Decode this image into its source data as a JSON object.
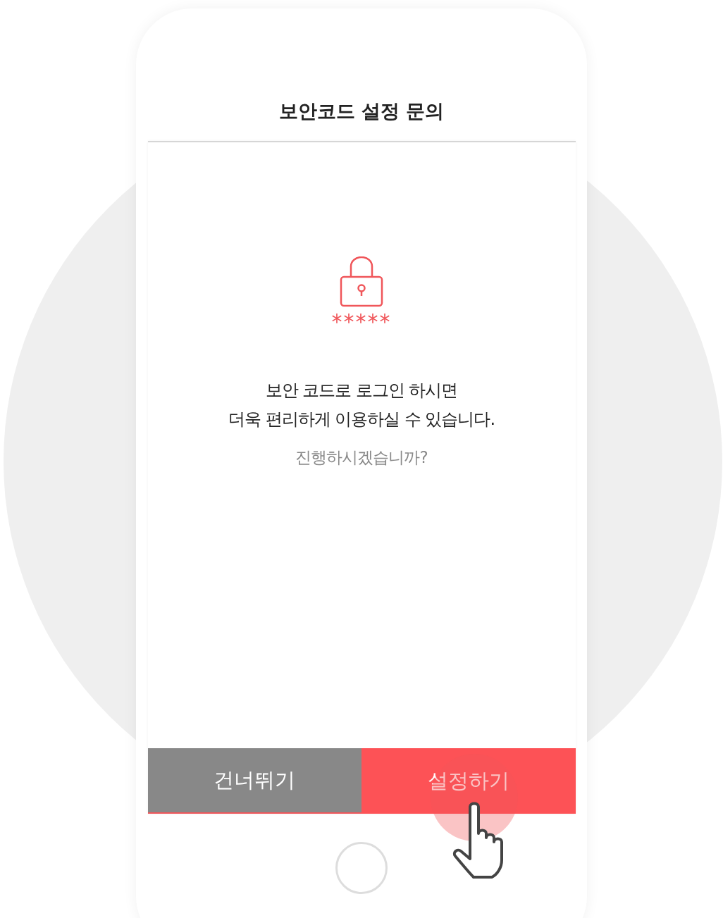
{
  "title": "보안코드 설정 문의",
  "masked_code": "*****",
  "message_lines": [
    "보안 코드로 로그인 하시면",
    "더욱 편리하게 이용하실 수 있습니다."
  ],
  "question": "진행하시겠습니까?",
  "buttons": [
    {
      "label": "건너뛰기",
      "kind": "secondary"
    },
    {
      "label": "설정하기",
      "kind": "primary"
    }
  ]
}
